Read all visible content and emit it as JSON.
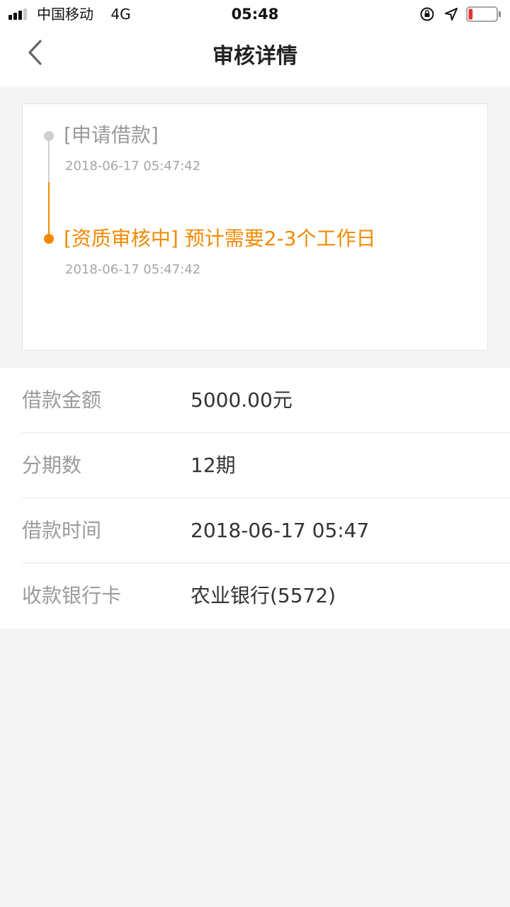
{
  "status_bar": {
    "carrier": "中国移动",
    "network": "4G",
    "time": "05:48",
    "icons": {
      "signal": "signal-icon",
      "lock": "rotation-lock-icon",
      "location": "location-arrow-icon",
      "battery": "battery-low-icon"
    },
    "battery_level": 0.15,
    "battery_color": "#e5342b"
  },
  "nav": {
    "title": "审核详情",
    "back_icon": "chevron-left-icon"
  },
  "timeline": {
    "accent_color": "#f28a00",
    "steps": [
      {
        "title": "[申请借款]",
        "time": "2018-06-17 05:47:42",
        "state": "done"
      },
      {
        "title": "[资质审核中] 预计需要2-3个工作日",
        "time": "2018-06-17 05:47:42",
        "state": "current"
      }
    ]
  },
  "details": [
    {
      "label": "借款金额",
      "value": "5000.00元"
    },
    {
      "label": "分期数",
      "value": "12期"
    },
    {
      "label": "借款时间",
      "value": "2018-06-17 05:47"
    },
    {
      "label": "收款银行卡",
      "value": "农业银行(5572)"
    }
  ]
}
